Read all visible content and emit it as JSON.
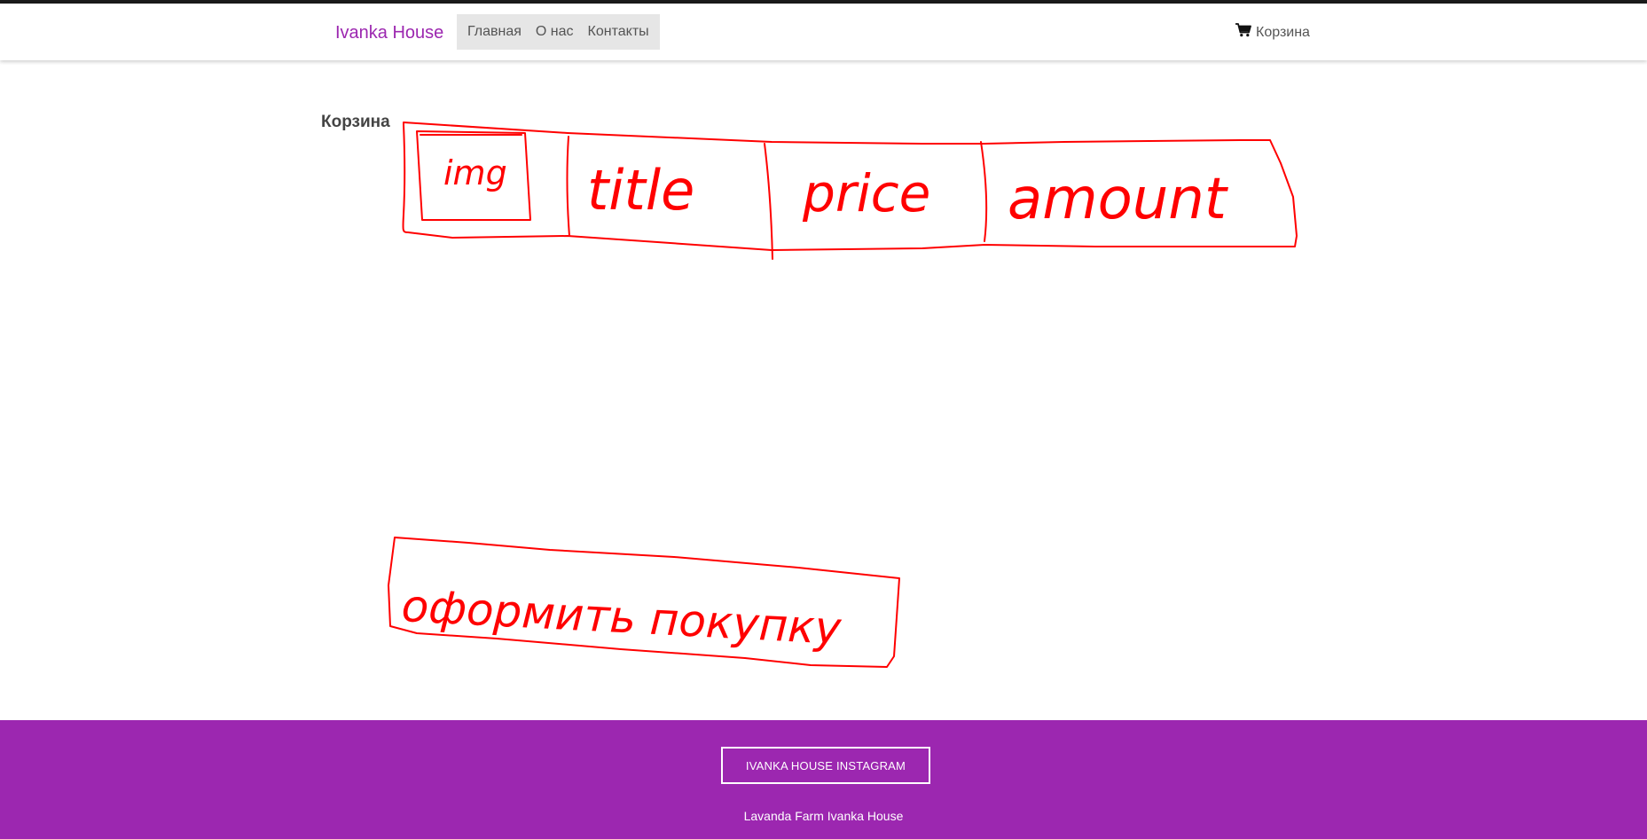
{
  "brand": "Ivanka House",
  "nav": {
    "items": [
      "Главная",
      "О нас",
      "Контакты"
    ]
  },
  "cart": {
    "label": "Корзина",
    "icon": "cart-icon"
  },
  "page": {
    "title": "Корзина"
  },
  "sketch": {
    "color": "#ff0000",
    "row_cells": [
      "img",
      "title",
      "price",
      "amount"
    ],
    "button_text": "оформить покупку"
  },
  "footer": {
    "button_label": "IVANKA HOUSE INSTAGRAM",
    "text": "Lavanda Farm Ivanka House"
  },
  "colors": {
    "brand": "#9c27b0",
    "sketch": "#ff0000"
  }
}
